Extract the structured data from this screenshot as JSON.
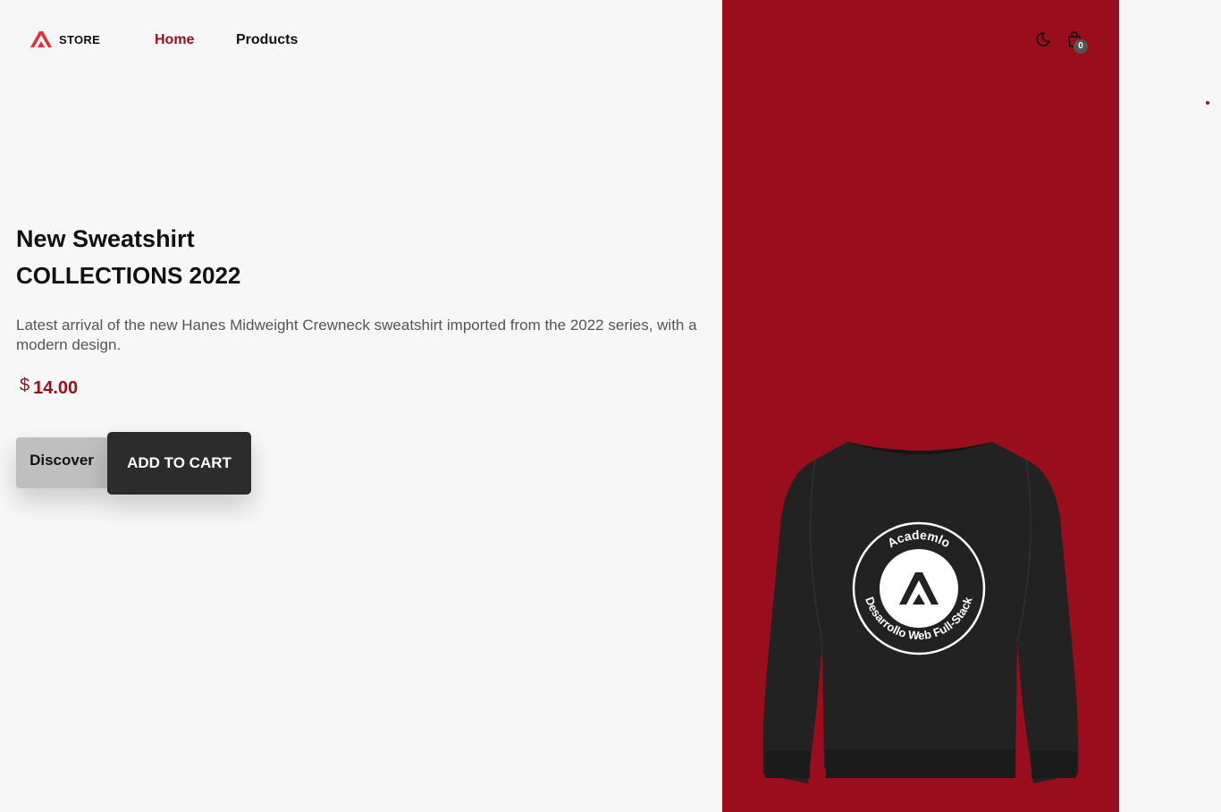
{
  "header": {
    "logo_text": "STORE",
    "nav": {
      "home": "Home",
      "products": "Products"
    },
    "cart_count": "0",
    "icons": {
      "theme_toggle": "moon-icon",
      "cart": "shopping-bag-icon"
    }
  },
  "hero": {
    "title_line1": "New Sweatshirt",
    "title_line2": "COLLECTIONS 2022",
    "description": "Latest arrival of the new Hanes Midweight Crewneck sweatshirt imported from the 2022 series, with a modern design.",
    "price_symbol": "$",
    "price": "14.00",
    "discover_label": "Discover",
    "add_to_cart_label": "ADD TO CART"
  },
  "product_image": {
    "print_top": "Academlo",
    "print_bottom": "Desarrollo Web Full-Stack"
  },
  "colors": {
    "brand": "#990d1c",
    "background": "#f7f7f7",
    "dark": "#2c2c2c"
  }
}
